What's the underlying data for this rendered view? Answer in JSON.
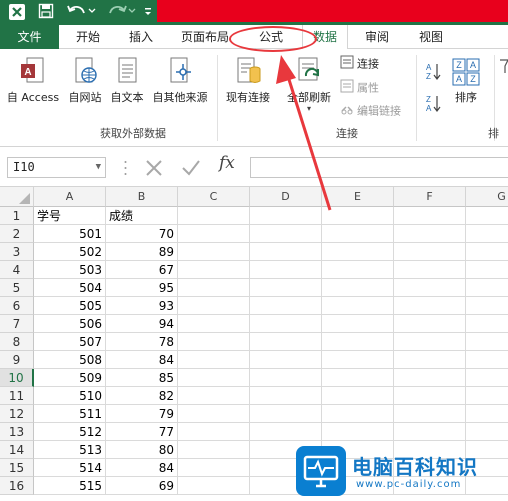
{
  "colors": {
    "excel_green": "#217346",
    "highlight_red": "#e8001c",
    "annotation_red": "#e8383d",
    "watermark_blue": "#1377c4"
  },
  "quick_access": {
    "save_icon": "save-icon",
    "undo_icon": "undo-icon",
    "redo_icon": "redo-icon"
  },
  "tabs": {
    "file": "文件",
    "items": [
      "开始",
      "插入",
      "页面布局",
      "公式",
      "数据",
      "审阅",
      "视图"
    ],
    "active": "数据"
  },
  "ribbon": {
    "get_external": {
      "buttons": [
        "自 Access",
        "自网站",
        "自文本",
        "自其他来源"
      ],
      "group_label": "获取外部数据"
    },
    "connections": {
      "existing": "现有连接",
      "refresh_all": "全部刷新",
      "small": [
        "连接",
        "属性",
        "编辑链接"
      ],
      "group_label": "连接"
    },
    "sort": {
      "sort_label": "排序",
      "group_label_partial": "排"
    }
  },
  "formula_bar": {
    "name_box": "I10",
    "fx": "fx",
    "formula": ""
  },
  "sheet": {
    "columns": [
      "A",
      "B",
      "C",
      "D",
      "E",
      "F",
      "G"
    ],
    "rows": [
      "1",
      "2",
      "3",
      "4",
      "5",
      "6",
      "7",
      "8",
      "9",
      "10",
      "11",
      "12",
      "13",
      "14",
      "15",
      "16"
    ],
    "selected_row": "10",
    "header": [
      "学号",
      "成绩"
    ],
    "data": [
      [
        "501",
        "70"
      ],
      [
        "502",
        "89"
      ],
      [
        "503",
        "67"
      ],
      [
        "504",
        "95"
      ],
      [
        "505",
        "93"
      ],
      [
        "506",
        "94"
      ],
      [
        "507",
        "78"
      ],
      [
        "508",
        "84"
      ],
      [
        "509",
        "85"
      ],
      [
        "510",
        "82"
      ],
      [
        "511",
        "79"
      ],
      [
        "512",
        "77"
      ],
      [
        "513",
        "80"
      ],
      [
        "514",
        "84"
      ],
      [
        "515",
        "69"
      ]
    ]
  },
  "watermark": {
    "title": "电脑百科知识",
    "url": "www.pc-daily.com"
  }
}
